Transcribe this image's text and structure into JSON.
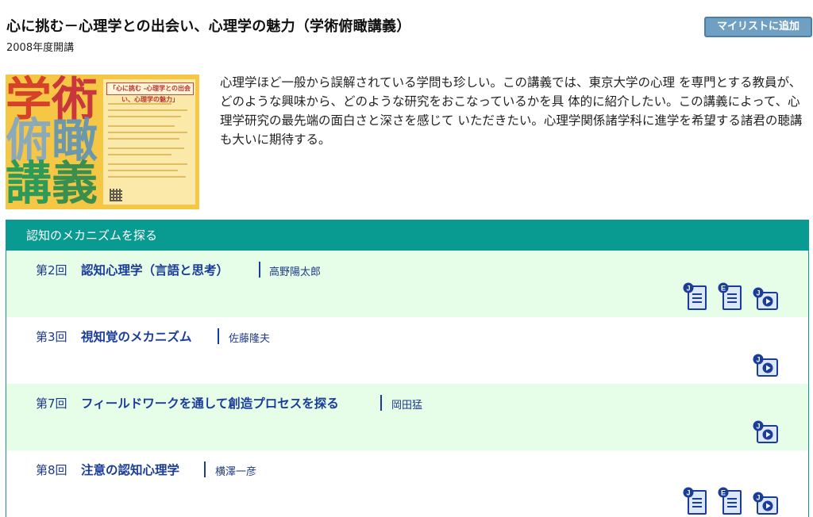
{
  "header": {
    "title": "心に挑む－心理学との出会い、心理学の魅力（学術俯瞰講義）",
    "subtitle": "2008年度開講",
    "mylist_button": "マイリストに追加"
  },
  "poster": {
    "characters": [
      "学",
      "術",
      "俯",
      "瞰",
      "講",
      "義"
    ],
    "heading": "「心に挑む -心理学との出会い、心理学の魅力」"
  },
  "description": "心理学ほど一般から誤解されている学問も珍しい。この講義では、東京大学の心理 を専門とする教員が、どのような興味から、どのような研究をおこなっているかを具 体的に紹介したい。この講義によって、心理学研究の最先端の面白さと深さを感じて いただきたい。心理学関係諸学科に進学を希望する諸君の聴講も大いに期待する。",
  "section": {
    "title": "認知のメカニズムを探る",
    "lectures": [
      {
        "number": "第2回",
        "title": "認知心理学（言語と思考）",
        "teacher": "高野陽太郎",
        "icons": [
          "japanese-document-icon",
          "english-document-icon",
          "japanese-video-icon"
        ]
      },
      {
        "number": "第3回",
        "title": "視知覚のメカニズム",
        "teacher": "佐藤隆夫",
        "icons": [
          "japanese-video-icon"
        ]
      },
      {
        "number": "第7回",
        "title": "フィールドワークを通して創造プロセスを探る",
        "teacher": "岡田猛",
        "icons": [
          "japanese-video-icon"
        ]
      },
      {
        "number": "第8回",
        "title": "注意の認知心理学",
        "teacher": "横澤一彦",
        "icons": [
          "japanese-document-icon",
          "english-document-icon",
          "japanese-video-icon"
        ]
      }
    ]
  },
  "icon_letters": {
    "japanese": "J",
    "english": "E"
  },
  "colors": {
    "header_bar": "#099b91",
    "row_highlight": "#e6fde8",
    "link": "#1a3c9a",
    "button": "#6fa0c3"
  }
}
